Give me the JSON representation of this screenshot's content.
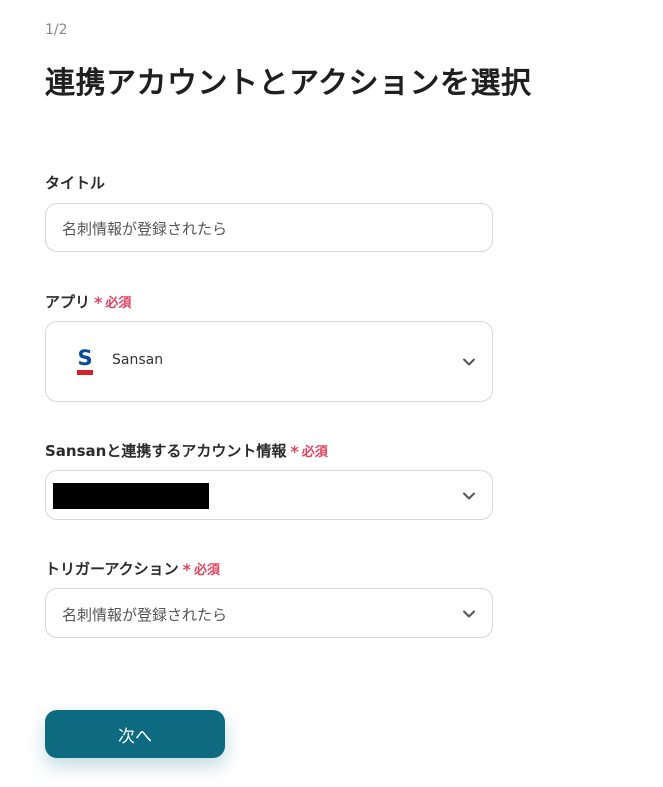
{
  "step": "1/2",
  "title": "連携アカウントとアクションを選択",
  "fields": {
    "title_label": "タイトル",
    "title_value": "名刺情報が登録されたら",
    "app_label": "アプリ",
    "app_required": "必須",
    "app_name": "Sansan",
    "account_label": "Sansanと連携するアカウント情報",
    "account_required": "必須",
    "trigger_label": "トリガーアクション",
    "trigger_required": "必須",
    "trigger_value": "名刺情報が登録されたら"
  },
  "next_button": "次へ",
  "colors": {
    "accent": "#0d6a80",
    "required": "#e0455f",
    "sansan_blue": "#0a4a9a",
    "sansan_red": "#d6202e"
  },
  "icons": {
    "chevron": "chevron-down-icon",
    "app": "sansan-logo-icon"
  }
}
